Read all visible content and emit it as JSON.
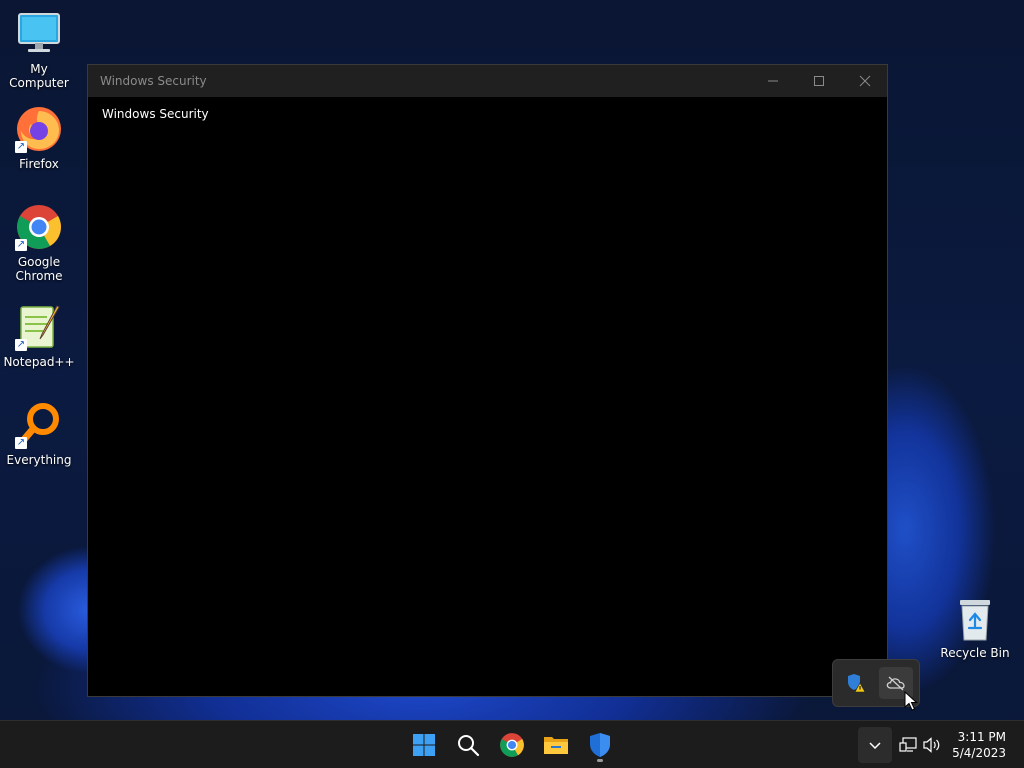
{
  "desktop": {
    "icons": [
      {
        "label": "My Computer",
        "icon": "computer-icon"
      },
      {
        "label": "Firefox",
        "icon": "firefox-icon"
      },
      {
        "label": "Google Chrome",
        "icon": "chrome-icon"
      },
      {
        "label": "Notepad++",
        "icon": "notepadpp-icon"
      },
      {
        "label": "Everything",
        "icon": "everything-icon"
      }
    ],
    "recycle_bin": {
      "label": "Recycle Bin",
      "icon": "recycle-bin-icon"
    }
  },
  "window": {
    "title": "Windows Security",
    "content_title": "Windows Security",
    "controls": {
      "minimize": "minimize-icon",
      "maximize": "maximize-icon",
      "close": "close-icon"
    }
  },
  "tray_overflow": {
    "items": [
      {
        "name": "security-warning",
        "icon": "shield-warning-icon"
      },
      {
        "name": "onedrive-offline",
        "icon": "cloud-off-icon"
      }
    ]
  },
  "taskbar": {
    "apps": [
      {
        "name": "start",
        "icon": "windows-logo-icon"
      },
      {
        "name": "search",
        "icon": "search-icon"
      },
      {
        "name": "chrome",
        "icon": "chrome-icon"
      },
      {
        "name": "file-explorer",
        "icon": "folder-icon"
      },
      {
        "name": "windows-security",
        "icon": "shield-icon",
        "running": true
      }
    ],
    "tray": {
      "overflow_chevron": "chevron-up-icon",
      "network": "network-icon",
      "volume": "speaker-icon"
    },
    "clock": {
      "time": "3:11 PM",
      "date": "5/4/2023"
    }
  },
  "colors": {
    "accent": "#0078d4",
    "window_bg": "#000000",
    "titlebar_bg": "#202020",
    "taskbar_bg": "#1c1c1c"
  }
}
